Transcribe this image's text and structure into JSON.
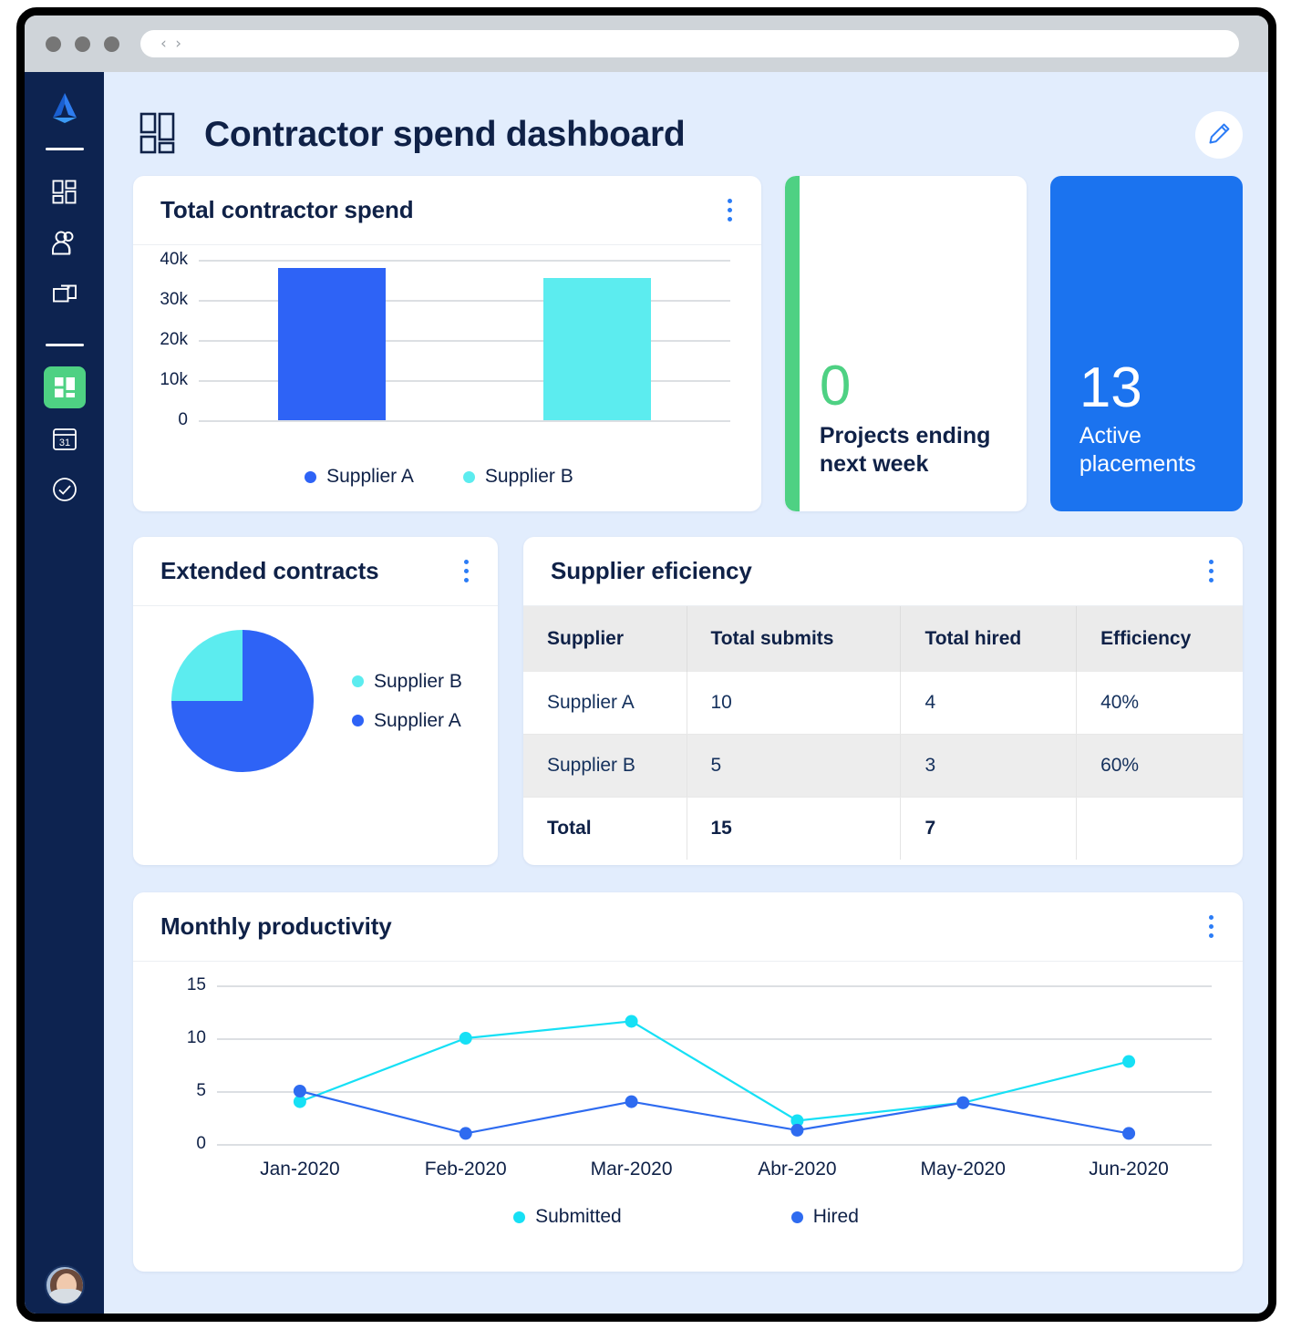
{
  "browser": {
    "nav_back_icon": "chevron-left-icon",
    "nav_forward_icon": "chevron-right-icon",
    "url_value": "",
    "url_placeholder": ""
  },
  "sidebar": {
    "logo_name": "app-logo",
    "items": [
      {
        "icon": "dashboard-grid-icon",
        "active": false
      },
      {
        "icon": "people-icon",
        "active": false
      },
      {
        "icon": "folders-icon",
        "active": false
      },
      {
        "icon": "dashboards-icon",
        "active": true
      },
      {
        "icon": "calendar-icon",
        "calendar_day": "31",
        "active": false
      },
      {
        "icon": "check-circle-icon",
        "active": false
      }
    ],
    "avatar_name": "user-avatar"
  },
  "header": {
    "title": "Contractor spend dashboard",
    "title_icon": "dashboard-layout-icon",
    "edit_icon": "pencil-icon"
  },
  "cards": {
    "spend": {
      "title": "Total contractor spend",
      "menu_icon": "kebab-menu-icon"
    },
    "projects": {
      "value": "0",
      "label": "Projects ending next week",
      "accent_color": "#4ed183"
    },
    "placements": {
      "value": "13",
      "label": "Active placements",
      "background_color": "#1b73ef"
    },
    "extended": {
      "title": "Extended contracts",
      "menu_icon": "kebab-menu-icon"
    },
    "efficiency": {
      "title": "Supplier eficiency",
      "menu_icon": "kebab-menu-icon"
    },
    "monthly": {
      "title": "Monthly productivity",
      "menu_icon": "kebab-menu-icon"
    }
  },
  "efficiency_table": {
    "columns": [
      "Supplier",
      "Total submits",
      "Total hired",
      "Efficiency"
    ],
    "rows": [
      [
        "Supplier A",
        "10",
        "4",
        "40%"
      ],
      [
        "Supplier B",
        "5",
        "3",
        "60%"
      ],
      [
        "Total",
        "15",
        "7",
        ""
      ]
    ]
  },
  "colors": {
    "supplier_a": "#2e63f6",
    "supplier_b": "#5cecef",
    "submitted": "#16e0f5",
    "hired": "#2e6bf0",
    "text_dark": "#0f2147",
    "canvas": "#e2edfd"
  },
  "chart_data": [
    {
      "type": "bar",
      "title": "Total contractor spend",
      "categories": [
        "Supplier A",
        "Supplier B"
      ],
      "values": [
        38000,
        35500
      ],
      "legend": [
        "Supplier A",
        "Supplier B"
      ],
      "legend_position": "bottom",
      "colors": [
        "#2e63f6",
        "#5cecef"
      ],
      "ytick_labels": [
        "40k",
        "30k",
        "20k",
        "10k",
        "0"
      ],
      "ytick_values": [
        40000,
        30000,
        20000,
        10000,
        0
      ],
      "ylim": [
        0,
        42000
      ],
      "xlabel": "",
      "ylabel": "",
      "grid": true
    },
    {
      "type": "pie",
      "title": "Extended contracts",
      "labels": [
        "Supplier B",
        "Supplier A"
      ],
      "values": [
        25,
        75
      ],
      "colors": [
        "#5cecef",
        "#2e63f6"
      ],
      "legend_position": "right"
    },
    {
      "type": "line",
      "title": "Monthly productivity",
      "x": [
        "Jan-2020",
        "Feb-2020",
        "Mar-2020",
        "Abr-2020",
        "May-2020",
        "Jun-2020"
      ],
      "series": [
        {
          "name": "Submitted",
          "values": [
            4,
            10,
            11.6,
            2.2,
            3.9,
            7.8
          ],
          "color": "#16e0f5"
        },
        {
          "name": "Hired",
          "values": [
            5,
            1,
            4,
            1.3,
            3.9,
            1
          ],
          "color": "#2e6bf0"
        }
      ],
      "ytick_labels": [
        "15",
        "10",
        "5",
        "0"
      ],
      "ytick_values": [
        15,
        10,
        5,
        0
      ],
      "ylim": [
        0,
        16
      ],
      "xlabel": "",
      "ylabel": "",
      "grid": true,
      "legend_position": "bottom"
    },
    {
      "type": "table",
      "title": "Supplier eficiency",
      "columns": [
        "Supplier",
        "Total submits",
        "Total hired",
        "Efficiency"
      ],
      "rows": [
        [
          "Supplier A",
          "10",
          "4",
          "40%"
        ],
        [
          "Supplier B",
          "5",
          "3",
          "60%"
        ],
        [
          "Total",
          "15",
          "7",
          ""
        ]
      ]
    }
  ]
}
